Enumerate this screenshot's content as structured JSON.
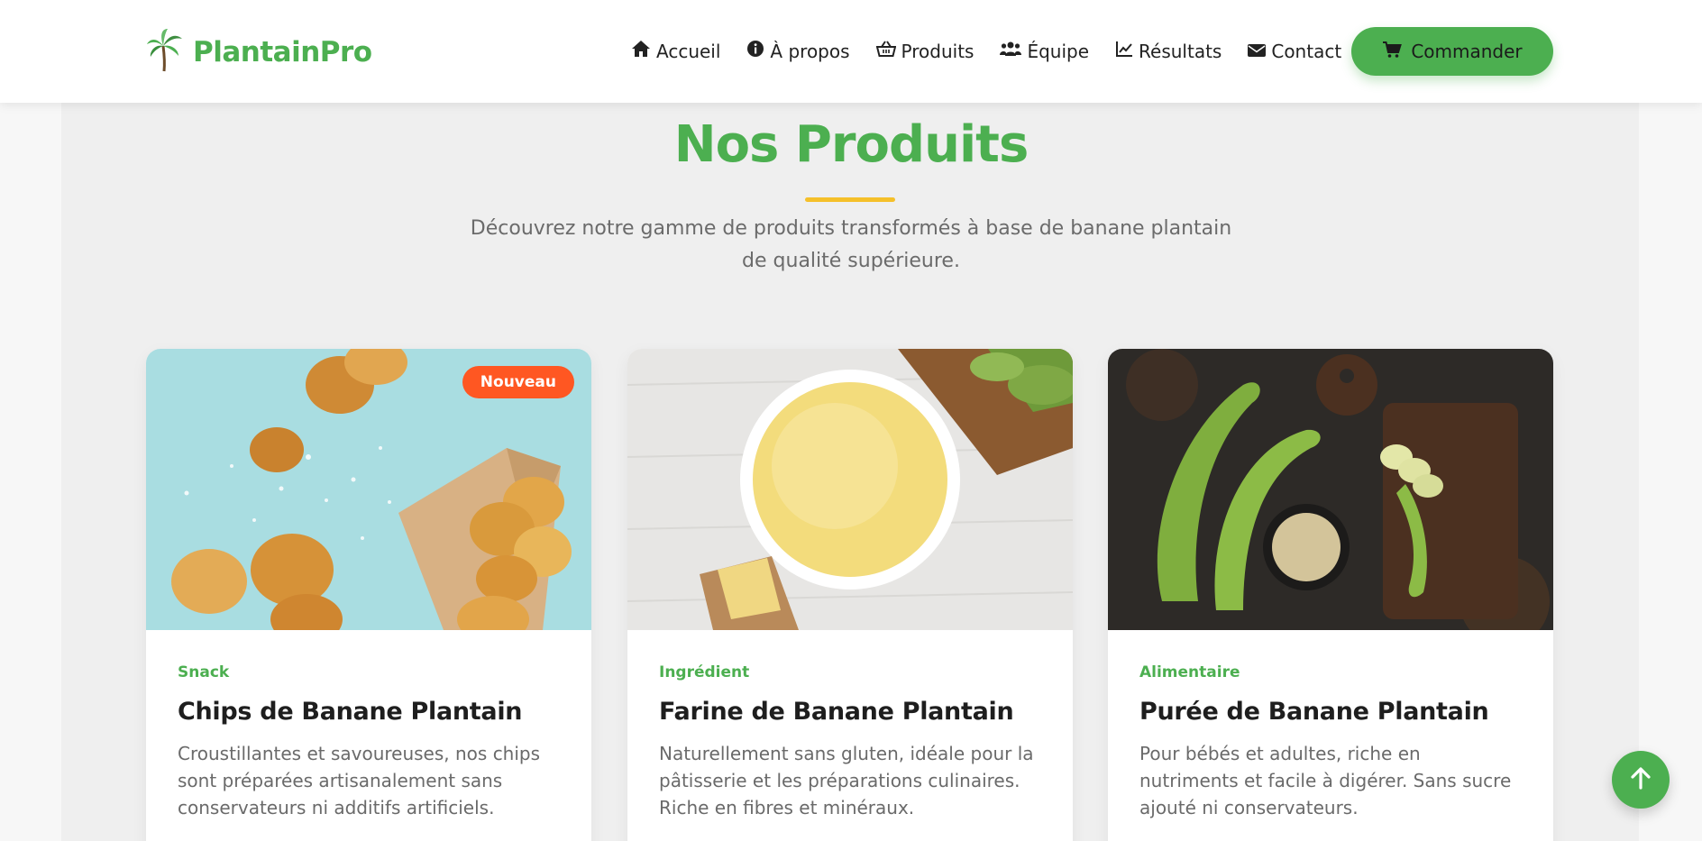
{
  "brand": {
    "name": "PlantainPro",
    "logo_icon": "palm-tree-icon"
  },
  "nav": {
    "items": [
      {
        "label": "Accueil",
        "icon": "home-icon"
      },
      {
        "label": "À propos",
        "icon": "info-circle-icon"
      },
      {
        "label": "Produits",
        "icon": "basket-icon"
      },
      {
        "label": "Équipe",
        "icon": "users-icon"
      },
      {
        "label": "Résultats",
        "icon": "chart-line-icon"
      },
      {
        "label": "Contact",
        "icon": "envelope-icon"
      }
    ],
    "cta": {
      "label": "Commander",
      "icon": "cart-icon"
    }
  },
  "section": {
    "title": "Nos Produits",
    "subtitle_line1": "Découvrez notre gamme de produits transformés à base de banane plantain",
    "subtitle_line2": "de qualité supérieure."
  },
  "products": [
    {
      "category": "Snack",
      "title": "Chips de Banane Plantain",
      "badge": "Nouveau",
      "description": "Croustillantes et savoureuses, nos chips sont préparées artisanalement sans conservateurs ni additifs artificiels."
    },
    {
      "category": "Ingrédient",
      "title": "Farine de Banane Plantain",
      "description": "Naturellement sans gluten, idéale pour la pâtisserie et les préparations culinaires. Riche en fibres et minéraux."
    },
    {
      "category": "Alimentaire",
      "title": "Purée de Banane Plantain",
      "description": "Pour bébés et adultes, riche en nutriments et facile à digérer. Sans sucre ajouté ni conservateurs."
    }
  ],
  "colors": {
    "primary": "#4caf50",
    "accent": "#f5c02a",
    "badge": "#ff5722",
    "text_dark": "#1e1e1e",
    "text_muted": "#6a6a6a"
  },
  "scroll_top": {
    "icon": "arrow-up-icon"
  }
}
